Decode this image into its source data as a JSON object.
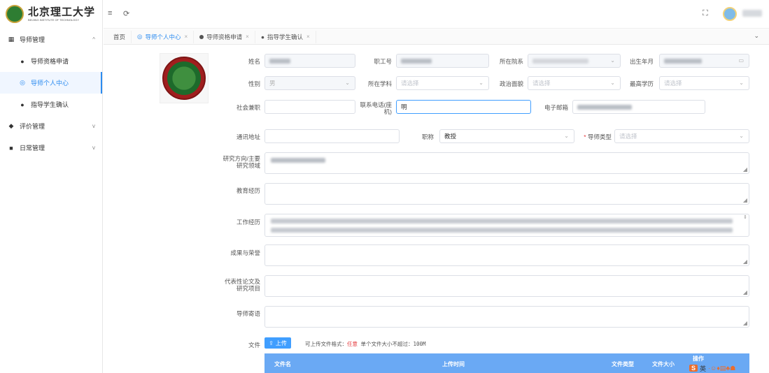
{
  "brand": {
    "name_cn": "北京理工大学",
    "name_en": "BEIJING INSTITUTE OF TECHNOLOGY"
  },
  "sidebar": {
    "groups": [
      {
        "label": "导师管理",
        "icon": "grid-icon",
        "expanded": true,
        "chevron": "^"
      },
      {
        "label": "评价管理",
        "icon": "tag-icon",
        "expanded": false,
        "chevron": "v"
      },
      {
        "label": "日常管理",
        "icon": "calendar-icon",
        "expanded": false,
        "chevron": "v"
      }
    ],
    "items": [
      {
        "label": "导师资格申请",
        "icon": "dot-icon"
      },
      {
        "label": "导师个人中心",
        "icon": "circle-dot-icon",
        "active": true
      },
      {
        "label": "指导学生确认",
        "icon": "apple-icon"
      }
    ]
  },
  "topbar": {
    "menu_icon": "≡",
    "refresh_icon": "⟳",
    "fullscreen_icon": "⛶"
  },
  "tabs": [
    {
      "label": "首页"
    },
    {
      "label": "导师个人中心",
      "close": "×",
      "active": true
    },
    {
      "label": "导师资格申请",
      "close": "×"
    },
    {
      "label": "指导学生确认",
      "close": "×"
    }
  ],
  "form": {
    "name": {
      "label": "姓名"
    },
    "staff_no": {
      "label": "职工号"
    },
    "department": {
      "label": "所在院系"
    },
    "birth": {
      "label": "出生年月"
    },
    "gender": {
      "label": "性别",
      "value": "男"
    },
    "discipline": {
      "label": "所在学科",
      "placeholder": "请选择"
    },
    "political": {
      "label": "政治面貌",
      "placeholder": "请选择"
    },
    "education": {
      "label": "最高学历",
      "placeholder": "请选择"
    },
    "social": {
      "label": "社会兼职"
    },
    "phone": {
      "label_l1": "联系电话(座",
      "label_l2": "机)",
      "value": "明"
    },
    "email": {
      "label": "电子邮箱"
    },
    "address": {
      "label": "通讯地址"
    },
    "title": {
      "label": "职称",
      "value": "教授"
    },
    "mentor_type": {
      "label": "导师类型",
      "required": "*",
      "placeholder": "请选择"
    },
    "research_l1": "研究方向/主要",
    "research_l2": "研究领域",
    "edu_exp": "教育经历",
    "work_exp": "工作经历",
    "achievements": "成果与荣誉",
    "papers_l1": "代表性论文及",
    "papers_l2": "研究项目",
    "message": "导师寄语"
  },
  "upload": {
    "label": "文件",
    "button": "上传",
    "tip_prefix": "可上传文件格式：",
    "tip_any": "任意",
    "tip_suffix": "单个文件大小不超过：100M"
  },
  "file_table": {
    "columns": [
      "文件名",
      "上传时间",
      "文件类型",
      "文件大小",
      "操作"
    ]
  },
  "ime": {
    "s": "S",
    "lang": "英"
  }
}
